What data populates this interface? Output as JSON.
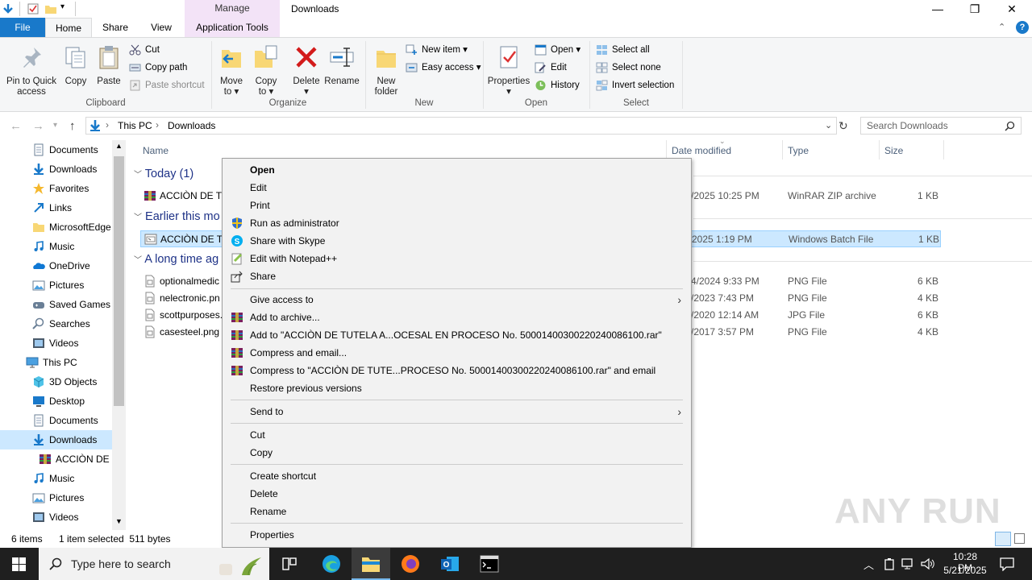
{
  "titlebar": {
    "context_tab_title": "Manage",
    "window_title": "Downloads",
    "minimize": "—",
    "maximize": "❐",
    "close": "✕"
  },
  "ribbon_tabs": {
    "file": "File",
    "home": "Home",
    "share": "Share",
    "view": "View",
    "app_tools": "Application Tools"
  },
  "ribbon": {
    "clipboard": {
      "pin_line1": "Pin to Quick",
      "pin_line2": "access",
      "copy": "Copy",
      "paste": "Paste",
      "cut": "Cut",
      "copy_path": "Copy path",
      "paste_shortcut": "Paste shortcut",
      "label": "Clipboard"
    },
    "organize": {
      "move_line1": "Move",
      "move_line2": "to ▾",
      "copy_line1": "Copy",
      "copy_line2": "to ▾",
      "delete_line1": "Delete",
      "delete_line2": "▾",
      "rename": "Rename",
      "label": "Organize"
    },
    "new": {
      "new_folder_line1": "New",
      "new_folder_line2": "folder",
      "new_item": "New item ▾",
      "easy_access": "Easy access ▾",
      "label": "New"
    },
    "open": {
      "properties_line1": "Properties",
      "properties_line2": "▾",
      "open": "Open ▾",
      "edit": "Edit",
      "history": "History",
      "label": "Open"
    },
    "select": {
      "select_all": "Select all",
      "select_none": "Select none",
      "invert": "Invert selection",
      "label": "Select"
    }
  },
  "address": {
    "crumbs": [
      "This PC",
      "Downloads"
    ],
    "search_placeholder": "Search Downloads"
  },
  "nav_items": [
    {
      "label": "Documents",
      "icon": "documents-icon"
    },
    {
      "label": "Downloads",
      "icon": "downloads-icon"
    },
    {
      "label": "Favorites",
      "icon": "favorites-icon"
    },
    {
      "label": "Links",
      "icon": "links-icon"
    },
    {
      "label": "MicrosoftEdge",
      "icon": "folder-icon"
    },
    {
      "label": "Music",
      "icon": "music-icon"
    },
    {
      "label": "OneDrive",
      "icon": "onedrive-icon"
    },
    {
      "label": "Pictures",
      "icon": "pictures-icon"
    },
    {
      "label": "Saved Games",
      "icon": "saved-games-icon"
    },
    {
      "label": "Searches",
      "icon": "searches-icon"
    },
    {
      "label": "Videos",
      "icon": "videos-icon"
    },
    {
      "label": "This PC",
      "icon": "this-pc-icon"
    },
    {
      "label": "3D Objects",
      "icon": "3d-objects-icon"
    },
    {
      "label": "Desktop",
      "icon": "desktop-icon"
    },
    {
      "label": "Documents",
      "icon": "documents-icon"
    },
    {
      "label": "Downloads",
      "icon": "downloads-icon"
    },
    {
      "label": "ACCIÒN DE T",
      "icon": "winrar-icon"
    },
    {
      "label": "Music",
      "icon": "music-icon"
    },
    {
      "label": "Pictures",
      "icon": "pictures-icon"
    },
    {
      "label": "Videos",
      "icon": "videos-icon"
    }
  ],
  "columns": {
    "name": "Name",
    "date": "Date modified",
    "type": "Type",
    "size": "Size"
  },
  "groups": {
    "today": "Today (1)",
    "earlier": "Earlier this mo",
    "longago": "A long time ag"
  },
  "files": [
    {
      "name": "ACCIÒN DE TU",
      "date": "/2025 10:25 PM",
      "type": "WinRAR ZIP archive",
      "size": "1 KB"
    },
    {
      "name": "ACCIÒN DE TU",
      "date": "2025 1:19 PM",
      "type": "Windows Batch File",
      "size": "1 KB"
    },
    {
      "name": "optionalmedic",
      "date": "4/2024 9:33 PM",
      "type": "PNG File",
      "size": "6 KB"
    },
    {
      "name": "nelectronic.pn",
      "date": "/2023 7:43 PM",
      "type": "PNG File",
      "size": "4 KB"
    },
    {
      "name": "scottpurposes.",
      "date": "/2020 12:14 AM",
      "type": "JPG File",
      "size": "6 KB"
    },
    {
      "name": "casesteel.png",
      "date": "/2017 3:57 PM",
      "type": "PNG File",
      "size": "4 KB"
    }
  ],
  "status": {
    "items": "6 items",
    "selected": "1 item selected  511 bytes"
  },
  "context_menu": {
    "open": "Open",
    "edit": "Edit",
    "print": "Print",
    "run_admin": "Run as administrator",
    "skype": "Share with Skype",
    "notepad": "Edit with Notepad++",
    "share": "Share",
    "give_access": "Give access to",
    "add_archive": "Add to archive...",
    "add_to_rar": "Add to \"ACCIÒN DE TUTELA A...OCESAL EN PROCESO No. 50001400300220240086100.rar\"",
    "compress_email": "Compress and email...",
    "compress_rar_email": "Compress to \"ACCIÒN DE TUTE...PROCESO No. 50001400300220240086100.rar\" and email",
    "restore": "Restore previous versions",
    "send_to": "Send to",
    "cut": "Cut",
    "copy": "Copy",
    "create_shortcut": "Create shortcut",
    "delete": "Delete",
    "rename": "Rename",
    "properties": "Properties"
  },
  "taskbar": {
    "search_placeholder": "Type here to search",
    "time": "10:28 PM",
    "date": "5/21/2025"
  },
  "watermark": "ANY RUN",
  "colors": {
    "accent": "#1979ca",
    "selection": "#cce8ff",
    "taskbar": "#1f1f1f"
  }
}
